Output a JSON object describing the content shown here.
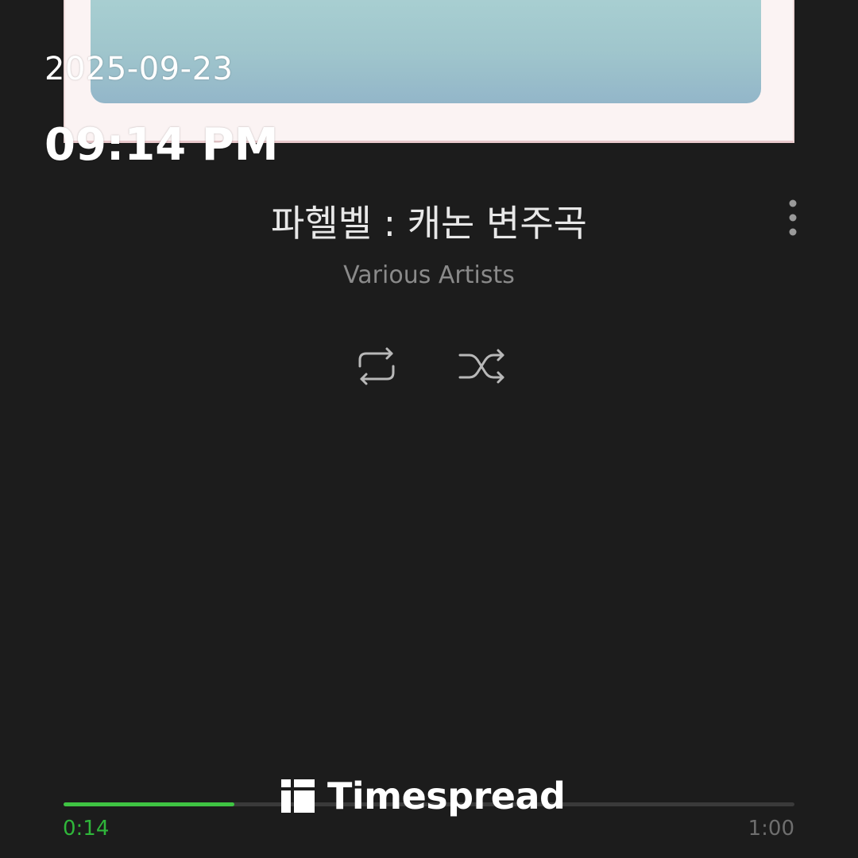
{
  "overlay": {
    "date": "2025-09-23",
    "time": "09:14 PM"
  },
  "track": {
    "title": "파헬벨 : 캐논 변주곡",
    "artist": "Various Artists"
  },
  "controls": {
    "more_icon": "more-vertical-icon",
    "repeat_icon": "repeat-icon",
    "shuffle_icon": "shuffle-icon"
  },
  "playback": {
    "elapsed": "0:14",
    "total": "1:00",
    "progress_fraction": 0.2333
  },
  "watermark": {
    "brand": "Timespread"
  },
  "colors": {
    "background": "#1c1c1c",
    "accent_progress": "#3fc443",
    "elapsed_text": "#2fb63a"
  }
}
